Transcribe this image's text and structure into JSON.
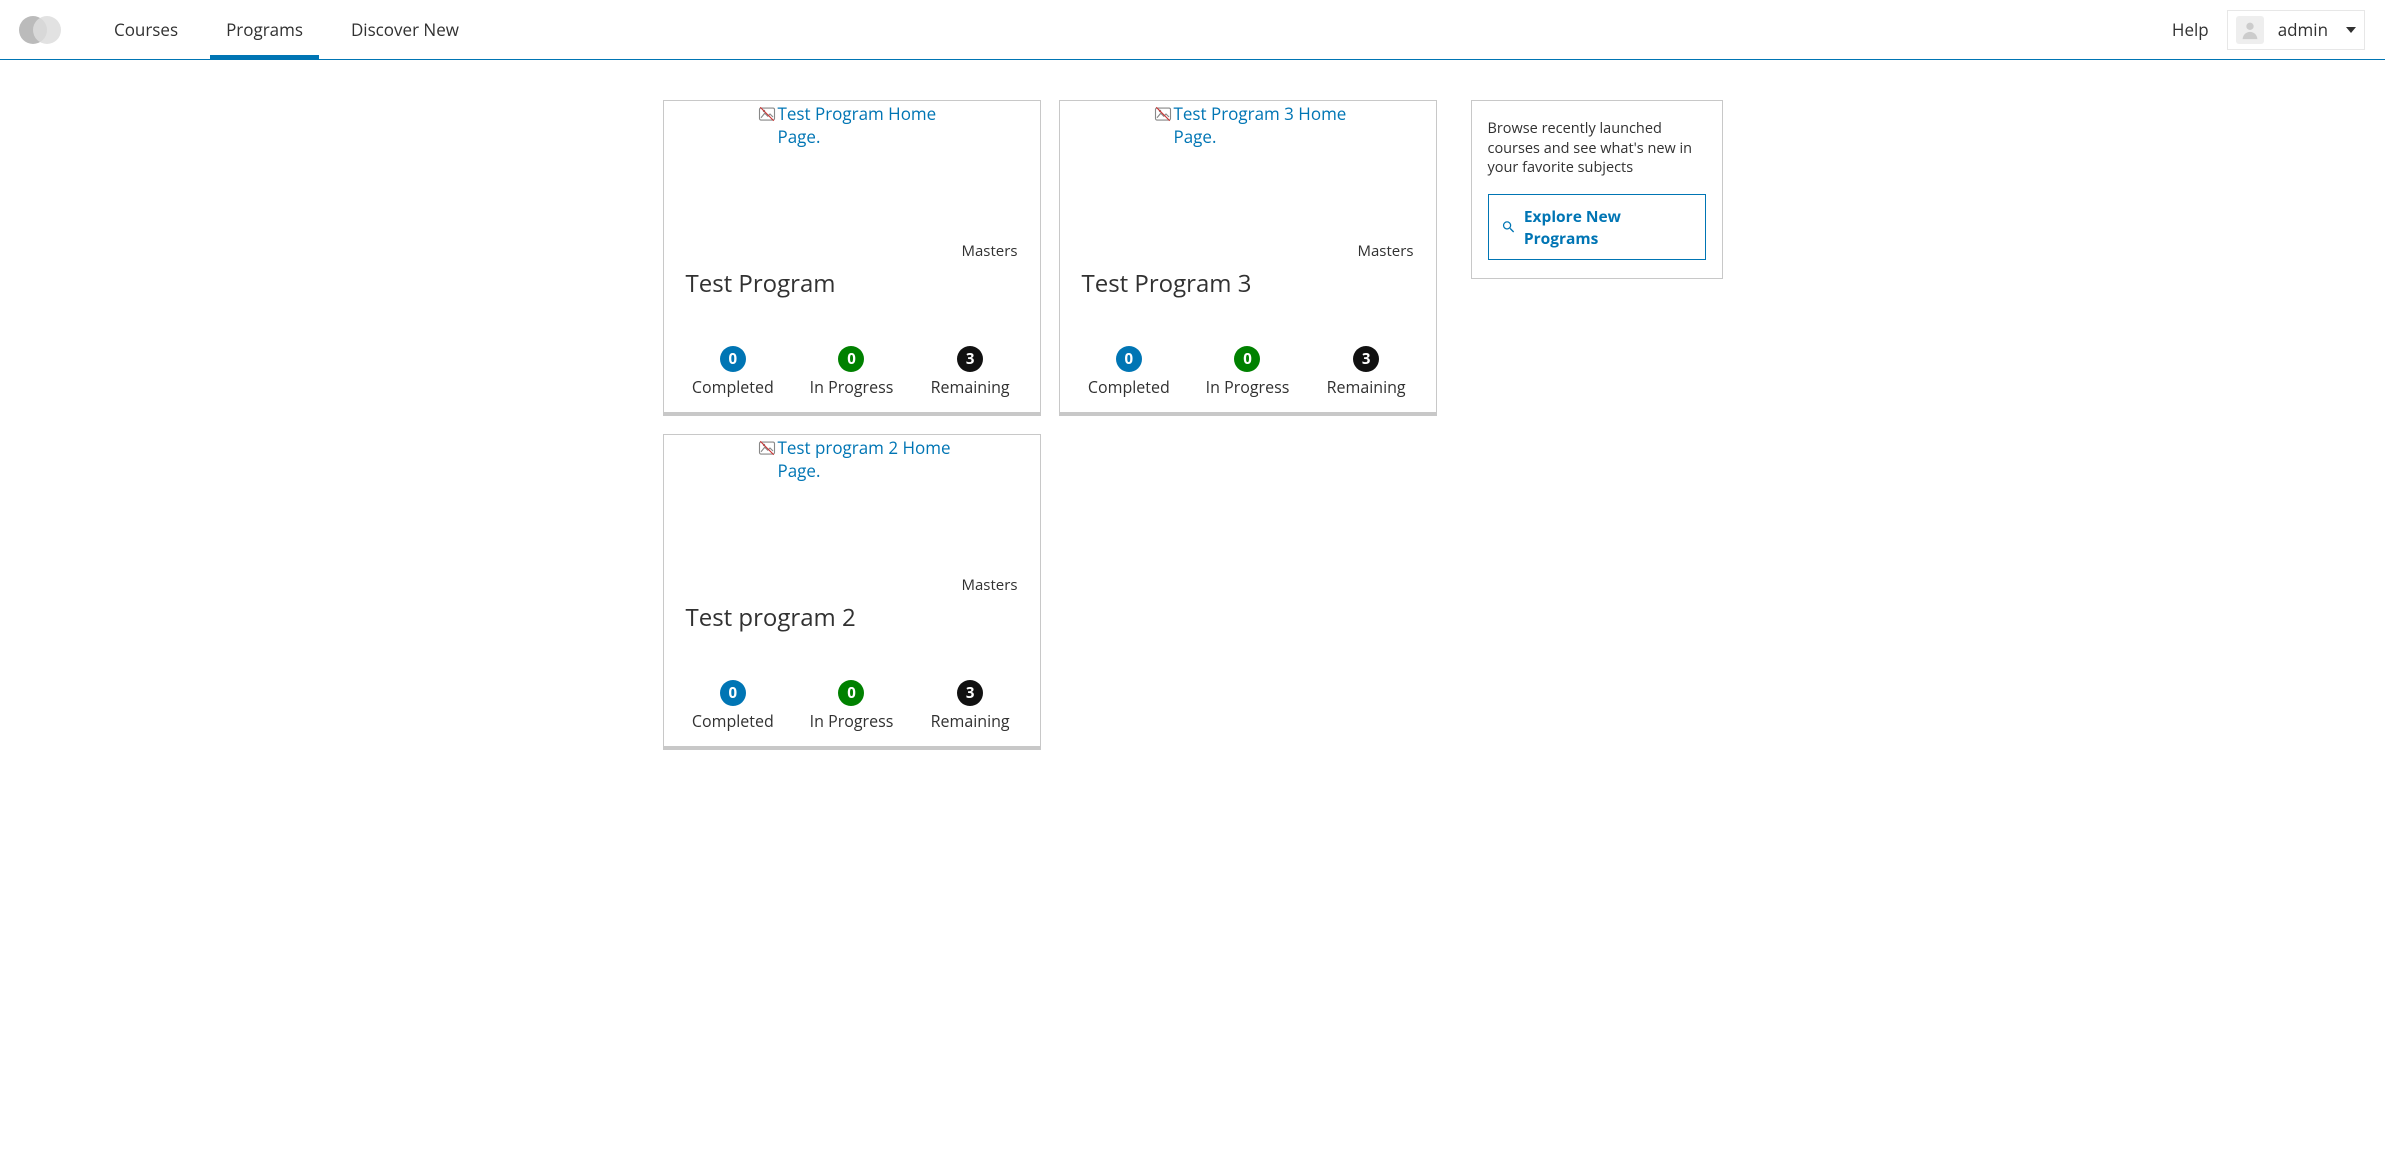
{
  "nav": {
    "tabs": [
      {
        "label": "Courses",
        "active": false
      },
      {
        "label": "Programs",
        "active": true
      },
      {
        "label": "Discover New",
        "active": false
      }
    ],
    "help_label": "Help",
    "user_name": "admin"
  },
  "promo": {
    "text": "Browse recently launched courses and see what's new in your favorite subjects",
    "button_label": "Explore New Programs"
  },
  "stat_labels": {
    "completed": "Completed",
    "in_progress": "In Progress",
    "remaining": "Remaining"
  },
  "programs": [
    {
      "title": "Test Program",
      "type": "Masters",
      "image_alt": "Test Program Home Page.",
      "completed": 0,
      "in_progress": 0,
      "remaining": 3
    },
    {
      "title": "Test Program 3",
      "type": "Masters",
      "image_alt": "Test Program 3 Home Page.",
      "completed": 0,
      "in_progress": 0,
      "remaining": 3
    },
    {
      "title": "Test program 2",
      "type": "Masters",
      "image_alt": "Test program 2 Home Page.",
      "completed": 0,
      "in_progress": 0,
      "remaining": 3
    }
  ]
}
